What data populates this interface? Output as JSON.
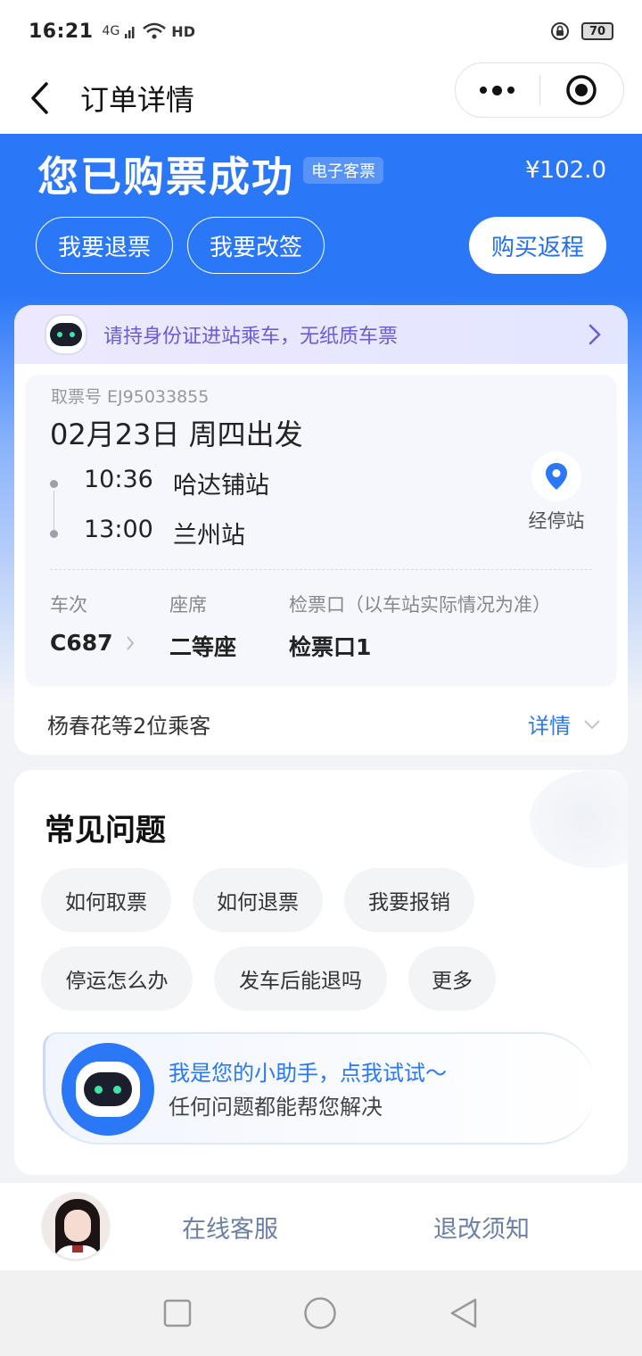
{
  "status_bar": {
    "time": "16:21",
    "signal": "4G",
    "hd": "HD",
    "battery": "70"
  },
  "nav": {
    "title": "订单详情"
  },
  "hero": {
    "title": "您已购票成功",
    "badge": "电子客票",
    "price": "¥102.0",
    "refund_label": "我要退票",
    "change_label": "我要改签",
    "return_label": "购买返程"
  },
  "notice": {
    "text": "请持身份证进站乘车，无纸质车票"
  },
  "ticket": {
    "pickup_no": "取票号 EJ95033855",
    "date": "02月23日 周四出发",
    "depart_time": "10:36",
    "depart_station": "哈达铺站",
    "arrive_time": "13:00",
    "arrive_station": "兰州站",
    "stops_label": "经停站",
    "train_label": "车次",
    "train_value": "C687",
    "seat_label": "座席",
    "seat_value": "二等座",
    "gate_label": "检票口（以车站实际情况为准）",
    "gate_value": "检票口1",
    "passengers": "杨春花等2位乘客",
    "detail_label": "详情"
  },
  "faq": {
    "title": "常见问题",
    "chips": [
      "如何取票",
      "如何退票",
      "我要报销",
      "停运怎么办",
      "发车后能退吗",
      "更多"
    ]
  },
  "assistant": {
    "line1": "我是您的小助手，点我试试～",
    "line2": "任何问题都能帮您解决"
  },
  "bottom_bar": {
    "service_label": "在线客服",
    "notice_label": "退改须知"
  },
  "colors": {
    "accent": "#2a77f7",
    "notice_text": "#6a5bd8"
  }
}
